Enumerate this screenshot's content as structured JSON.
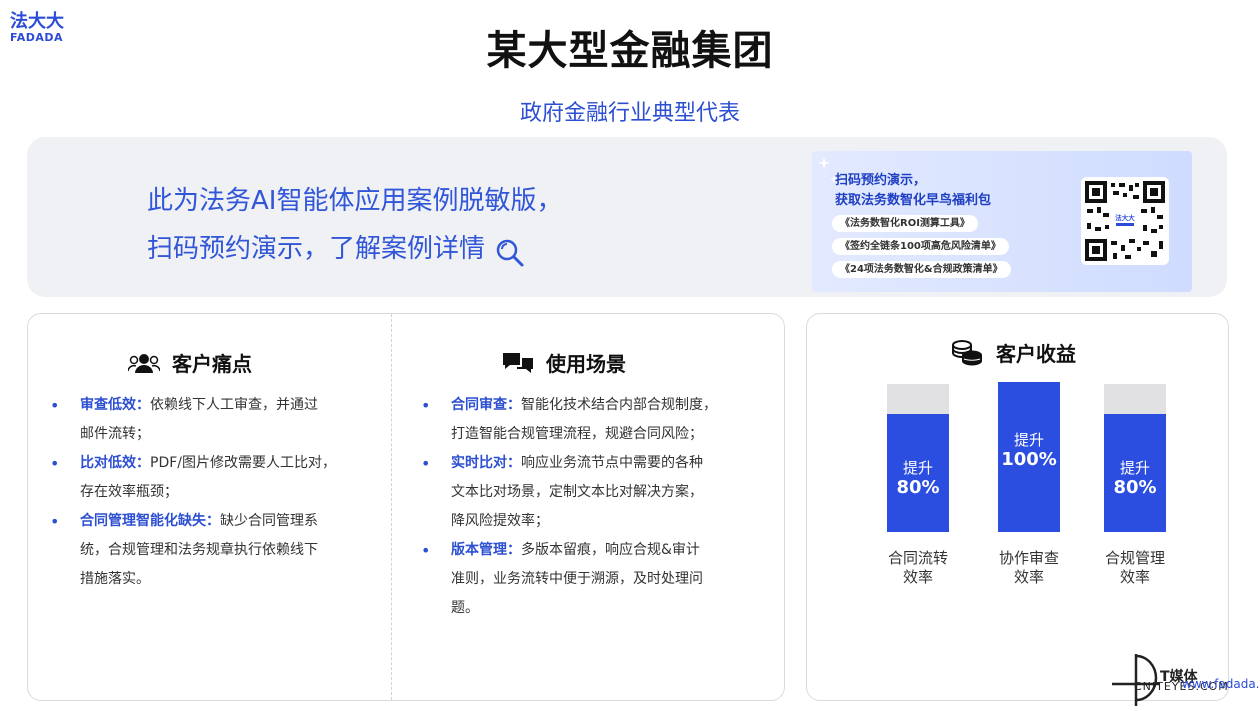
{
  "logo": {
    "cn": "法大大",
    "en": "FADADA"
  },
  "page": {
    "title": "某大型金融集团",
    "subtitle": "政府金融行业典型代表"
  },
  "banner": {
    "line1": "此为法务AI智能体应用案例脱敏版，",
    "line2": "扫码预约演示，了解案例详情",
    "promo": {
      "head1": "扫码预约演示，",
      "head2": "获取法务数智化早鸟福利包",
      "items": [
        "《法务数智化ROI测算工具》",
        "《签约全链条100项高危风险清单》",
        "《24项法务数智化&合规政策清单》"
      ],
      "qr_center": "法大大"
    }
  },
  "pain": {
    "title": "客户痛点",
    "items": [
      {
        "key": "审查低效：",
        "text": "依赖线下人工审查，并通过",
        "cont": "邮件流转；"
      },
      {
        "key": "比对低效：",
        "text": "PDF/图片修改需要人工比对，",
        "cont": "存在效率瓶颈；"
      },
      {
        "key": "合同管理智能化缺失：",
        "text": "缺少合同管理系",
        "cont": "统，合规管理和法务规章执行依赖线下",
        "cont2": "措施落实。"
      }
    ]
  },
  "scenes": {
    "title": "使用场景",
    "items": [
      {
        "key": "合同审查：",
        "text": "智能化技术结合内部合规制度，",
        "cont": "打造智能合规管理流程，规避合同风险；"
      },
      {
        "key": "实时比对：",
        "text": "响应业务流节点中需要的各种",
        "cont": "文本比对场景，定制文本比对解决方案，",
        "cont2": "降风险提效率；"
      },
      {
        "key": "版本管理：",
        "text": "多版本留痕，响应合规&审计",
        "cont": "准则，业务流转中便于溯源，及时处理问",
        "cont2": "题。"
      }
    ]
  },
  "benefit": {
    "title": "客户收益",
    "bars": [
      {
        "label1": "合同流转",
        "label2": "效率",
        "t1": "提升",
        "t2": "80%",
        "value": 80
      },
      {
        "label1": "协作审查",
        "label2": "效率",
        "t1": "提升",
        "t2": "100%",
        "value": 100
      },
      {
        "label1": "合规管理",
        "label2": "效率",
        "t1": "提升",
        "t2": "80%",
        "value": 80
      }
    ],
    "bar_color": "#2b4ee0",
    "track_color": "#e1e1e3"
  },
  "watermark": {
    "main": "T媒体",
    "sub": "CNITEYES.COM",
    "site": "www.fadada.com"
  }
}
